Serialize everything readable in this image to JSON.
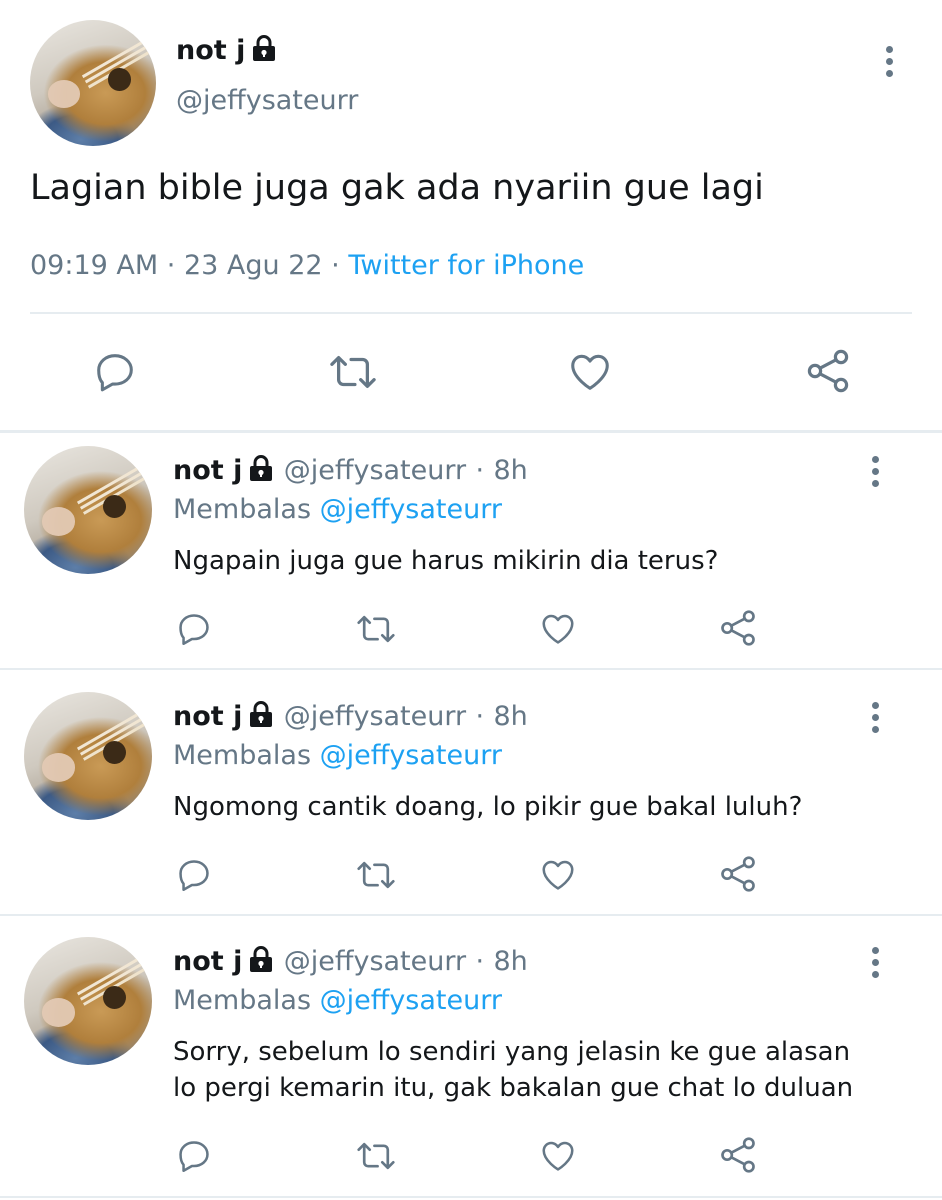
{
  "main_tweet": {
    "display_name": "not j",
    "handle": "@jeffysateurr",
    "text": "Lagian bible juga gak ada nyariin gue lagi",
    "time": "09:19 AM",
    "date": "23 Agu 22",
    "source": "Twitter for iPhone",
    "separator": "·"
  },
  "replies": [
    {
      "display_name": "not j",
      "handle": "@jeffysateurr",
      "age": "8h",
      "replying_label": "Membalas",
      "replying_to": "@jeffysateurr",
      "text_lines": [
        "Ngapain juga gue harus mikirin dia terus?"
      ]
    },
    {
      "display_name": "not j",
      "handle": "@jeffysateurr",
      "age": "8h",
      "replying_label": "Membalas",
      "replying_to": "@jeffysateurr",
      "text_lines": [
        "Ngomong cantik doang, lo pikir gue bakal luluh?"
      ]
    },
    {
      "display_name": "not j",
      "handle": "@jeffysateurr",
      "age": "8h",
      "replying_label": "Membalas",
      "replying_to": "@jeffysateurr",
      "text_lines": [
        "Sorry, sebelum lo sendiri yang jelasin ke gue alasan",
        "lo pergi kemarin itu, gak bakalan gue chat lo duluan"
      ]
    }
  ],
  "icons": [
    "reply-icon",
    "retweet-icon",
    "like-icon",
    "share-icon",
    "more-icon",
    "lock-icon"
  ],
  "colors": {
    "accent": "#1da1f2",
    "muted": "#657786",
    "text": "#14171a",
    "divider": "#e6ecf0"
  }
}
